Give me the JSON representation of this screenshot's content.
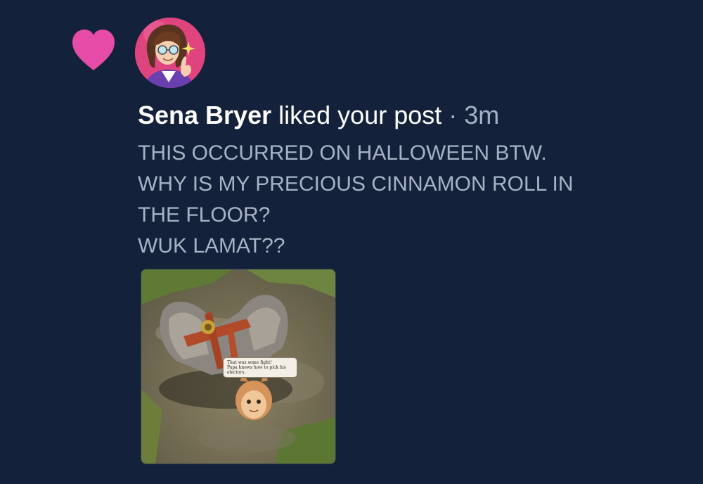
{
  "notification": {
    "icon": "heart-icon",
    "accent_color": "#e64ca8",
    "avatar": "user-avatar",
    "author": "Sena Bryer",
    "action": "liked your post",
    "separator": "·",
    "time": "3m"
  },
  "post": {
    "lines": [
      "THIS OCCURRED ON HALLOWEEN BTW.",
      "WHY IS MY PRECIOUS CINNAMON ROLL IN",
      "THE FLOOR?",
      "WUK LAMAT??"
    ],
    "image": {
      "caption_line1": "That was some fight!",
      "caption_line2": "Papa knows how to pick his",
      "caption_line3": "electors."
    }
  }
}
